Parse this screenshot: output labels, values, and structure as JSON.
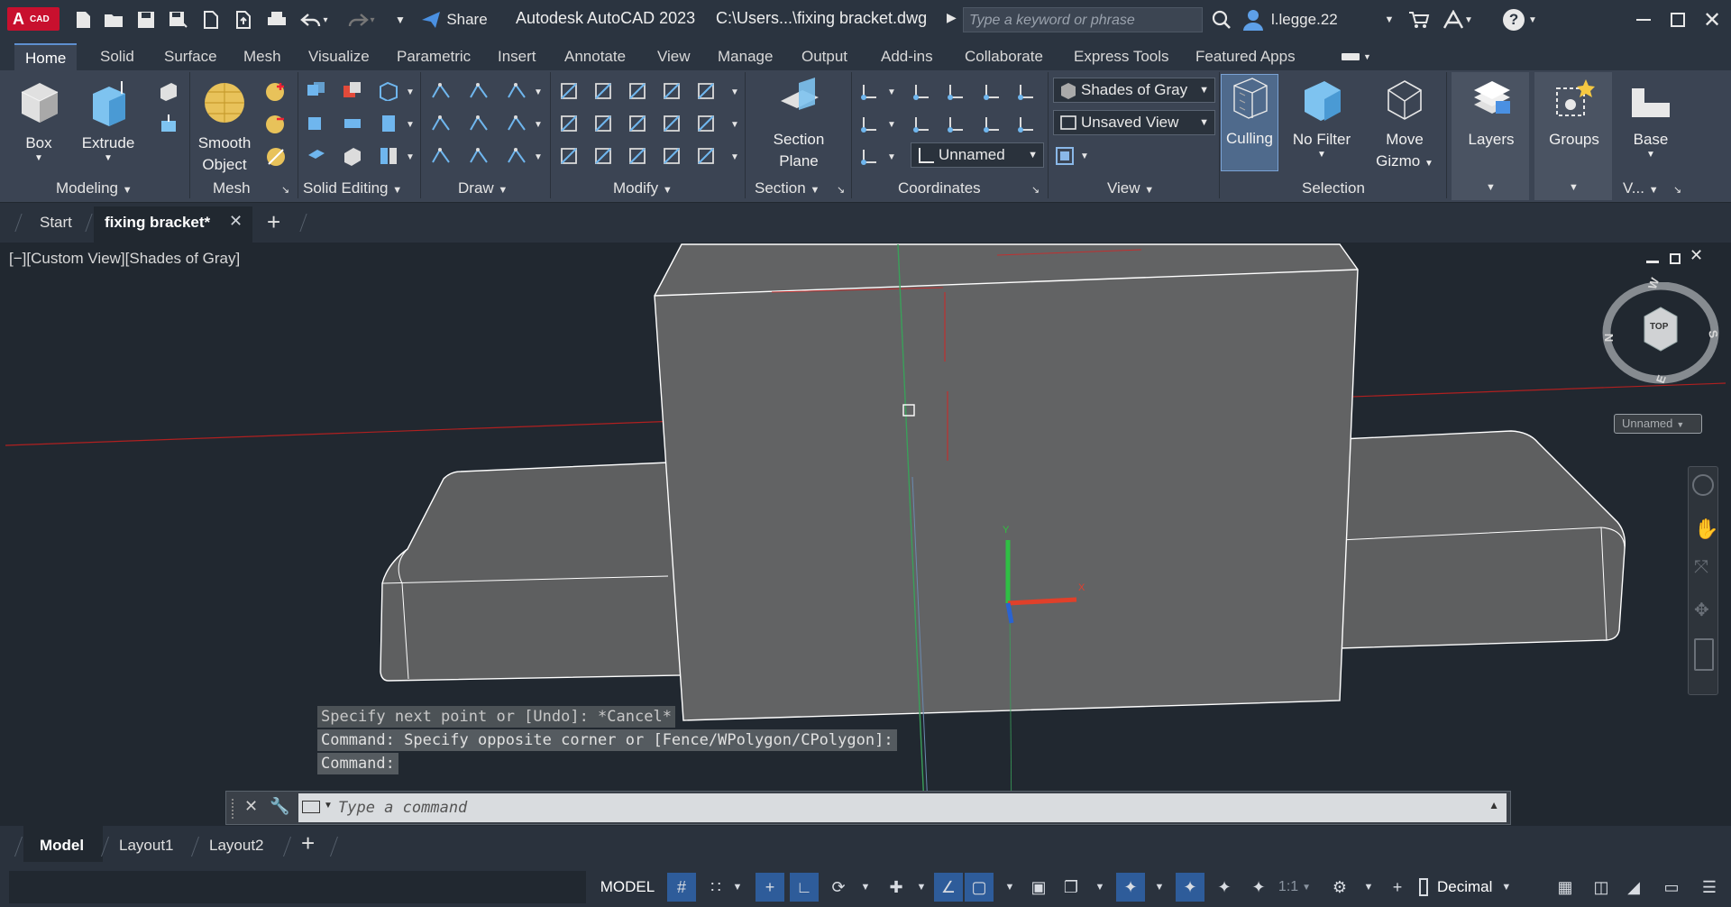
{
  "app": {
    "title": "Autodesk AutoCAD 2023",
    "path": "C:\\Users...\\fixing bracket.dwg",
    "logo_text": "CAD"
  },
  "titlebar": {
    "share_label": "Share",
    "search_placeholder": "Type a keyword or phrase",
    "user": "l.legge.22"
  },
  "menu_tabs": [
    "Home",
    "Solid",
    "Surface",
    "Mesh",
    "Visualize",
    "Parametric",
    "Insert",
    "Annotate",
    "View",
    "Manage",
    "Output",
    "Add-ins",
    "Collaborate",
    "Express Tools",
    "Featured Apps"
  ],
  "ribbon": {
    "modeling": {
      "label": "Modeling",
      "box": "Box",
      "extrude": "Extrude"
    },
    "mesh": {
      "label": "Mesh",
      "smooth_line1": "Smooth",
      "smooth_line2": "Object"
    },
    "solid_editing": {
      "label": "Solid Editing"
    },
    "draw": {
      "label": "Draw"
    },
    "modify": {
      "label": "Modify"
    },
    "section": {
      "label": "Section",
      "btn_line1": "Section",
      "btn_line2": "Plane"
    },
    "coordinates": {
      "label": "Coordinates",
      "ucs_value": "Unnamed"
    },
    "view": {
      "label": "View",
      "visual_style": "Shades of Gray",
      "named_view": "Unsaved View"
    },
    "selection": {
      "label": "Selection",
      "culling": "Culling",
      "no_filter": "No Filter",
      "move_line1": "Move",
      "move_line2": "Gizmo"
    },
    "layers": {
      "label": "Layers"
    },
    "groups": {
      "label": "Groups"
    },
    "base": {
      "label": "Base",
      "panel_label": "V..."
    }
  },
  "doc_tabs": {
    "start": "Start",
    "active": "fixing bracket*"
  },
  "viewport": {
    "label": "[−][Custom View][Shades of Gray]",
    "viewcube_top": "TOP",
    "compass": {
      "n": "N",
      "s": "S",
      "e": "E",
      "w": "W"
    },
    "ucs_name": "Unnamed"
  },
  "command": {
    "history": [
      "Specify next point or [Undo]: *Cancel*",
      "Command: Specify opposite corner or [Fence/WPolygon/CPolygon]:",
      "Command:"
    ],
    "placeholder": "Type a command"
  },
  "layout_tabs": [
    "Model",
    "Layout1",
    "Layout2"
  ],
  "statusbar": {
    "model": "MODEL",
    "scale": "1:1",
    "units": "Decimal"
  }
}
